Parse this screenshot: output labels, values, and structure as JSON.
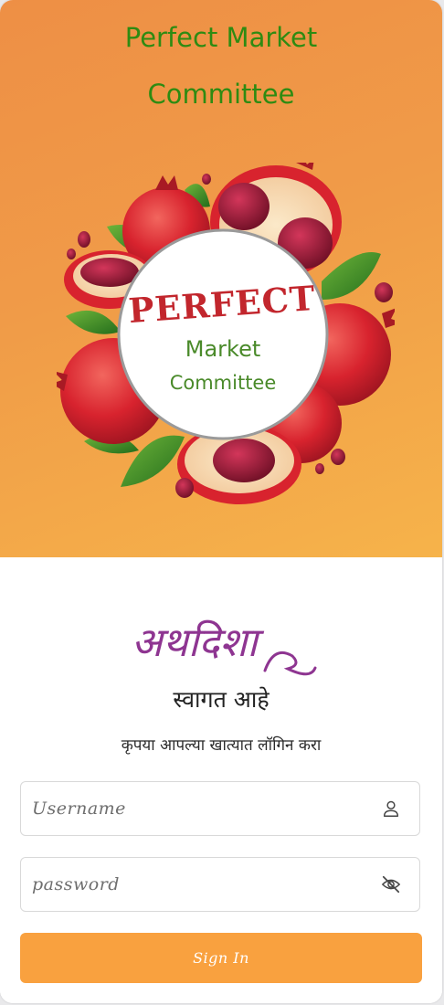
{
  "hero": {
    "title_line1": "Perfect Market",
    "title_line2": "Committee",
    "badge": {
      "word1": "PERFECT",
      "word2": "Market",
      "word3": "Committee"
    },
    "colors": {
      "title_green": "#2e8b12",
      "badge_red": "#c2262d",
      "badge_green": "#4a8a2a"
    }
  },
  "brand": {
    "logo_text": "अथदिशा",
    "logo_color": "#8e3591"
  },
  "welcome": {
    "heading": "स्वागत आहे",
    "subtitle": "कृपया आपल्या खात्यात लॉगिन करा"
  },
  "form": {
    "username": {
      "placeholder": "Username",
      "value": "",
      "icon": "user-icon"
    },
    "password": {
      "placeholder": "password",
      "value": "",
      "icon": "eye-off-icon"
    },
    "submit_label": "Sign In",
    "accent": "#f9a13f"
  }
}
